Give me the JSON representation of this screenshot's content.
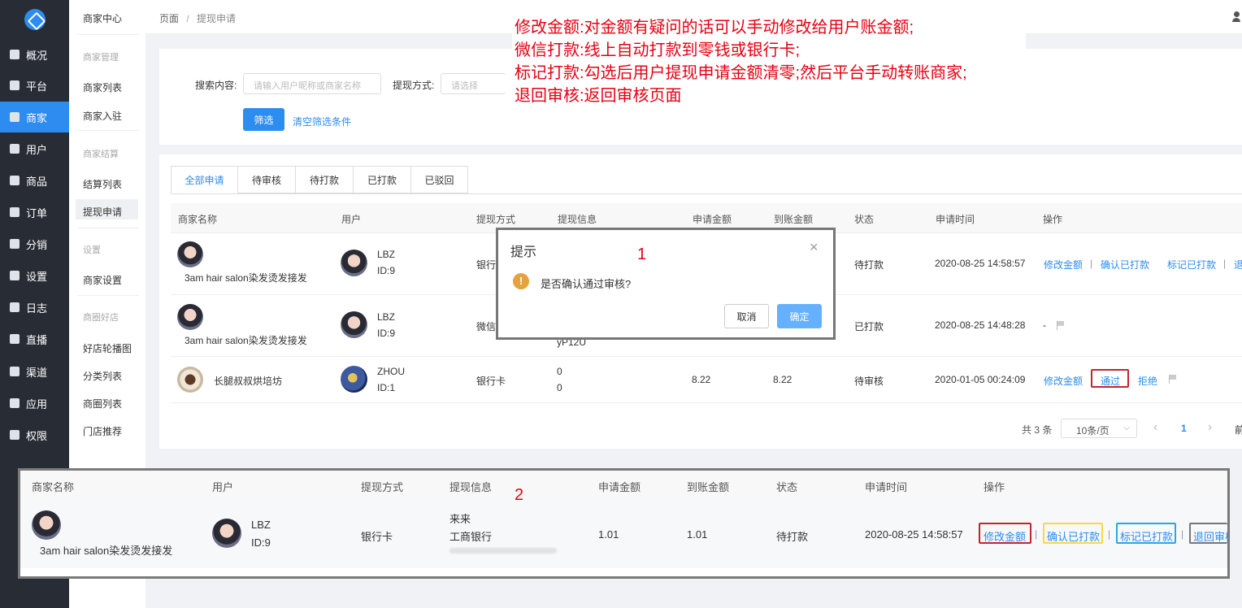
{
  "sidebar": {
    "items": [
      {
        "label": "概况",
        "icon": "dashboard-icon"
      },
      {
        "label": "平台",
        "icon": "monitor-icon"
      },
      {
        "label": "商家",
        "icon": "shop-icon",
        "active": true
      },
      {
        "label": "用户",
        "icon": "user-icon"
      },
      {
        "label": "商品",
        "icon": "goods-icon"
      },
      {
        "label": "订单",
        "icon": "order-icon"
      },
      {
        "label": "分销",
        "icon": "sitemap-icon"
      },
      {
        "label": "设置",
        "icon": "gear-icon"
      },
      {
        "label": "日志",
        "icon": "book-icon"
      },
      {
        "label": "直播",
        "icon": "live-icon"
      },
      {
        "label": "渠道",
        "icon": "channel-icon"
      },
      {
        "label": "应用",
        "icon": "apps-icon"
      },
      {
        "label": "权限",
        "icon": "lock-icon"
      }
    ]
  },
  "submenu": {
    "title": "商家中心",
    "g1": "商家管理",
    "list": "商家列表",
    "settle_in": "商家入驻",
    "g2": "商家结算",
    "settle_list": "结算列表",
    "withdraw": "提现申请",
    "g3": "设置",
    "shop_settings": "商家设置",
    "g4": "商圈好店",
    "carousel": "好店轮播图",
    "category": "分类列表",
    "circle": "商圈列表",
    "recommend": "门店推荐"
  },
  "breadcrumb": {
    "root": "页面",
    "sep": "/",
    "current": "提现申请"
  },
  "filter": {
    "search_label": "搜索内容:",
    "search_placeholder": "请输入用户昵称或商家名称",
    "method_label": "提现方式:",
    "method_placeholder": "请选择",
    "submit": "筛选",
    "clear": "清空筛选条件"
  },
  "tabs": [
    "全部申请",
    "待审核",
    "待打款",
    "已打款",
    "已驳回"
  ],
  "table": {
    "headers": [
      "商家名称",
      "用户",
      "提现方式",
      "提现信息",
      "申请金额",
      "到账金额",
      "状态",
      "申请时间",
      "操作"
    ],
    "rows": [
      {
        "shop": "3am hair salon染发烫发接发",
        "user": "LBZ",
        "uid": "ID:9",
        "method": "银行",
        "status": "待打款",
        "time": "2020-08-25 14:58:57",
        "ops": [
          "修改金额",
          "|",
          "确认已打款",
          "标记已打款",
          "|",
          "退"
        ]
      },
      {
        "shop": "3am hair salon染发烫发接发",
        "user": "LBZ",
        "uid": "ID:9",
        "method": "微信",
        "info": "yP12U",
        "status": "已打款",
        "time": "2020-08-25 14:48:28",
        "dash": "-"
      },
      {
        "shop": "长腿叔叔烘培坊",
        "user": "ZHOU",
        "uid": "ID:1",
        "method": "银行卡",
        "info1": "0",
        "info2": "0",
        "apply": "8.22",
        "arrive": "8.22",
        "status": "待审核",
        "time": "2020-01-05 00:24:09",
        "ops": [
          "修改金额",
          "通过",
          "拒绝"
        ]
      }
    ]
  },
  "pagination": {
    "total": "共 3 条",
    "size": "10条/页",
    "prev": "‹",
    "page": "1",
    "next": "›",
    "more": "前"
  },
  "dialog": {
    "title": "提示",
    "message": "是否确认通过审核?",
    "cancel": "取消",
    "ok": "确定",
    "close": "×",
    "warn": "!"
  },
  "markers": {
    "one": "1",
    "two": "2"
  },
  "annotations": [
    "修改金额:对金额有疑问的话可以手动修改给用户账金额;",
    "微信打款:线上自动打款到零钱或银行卡;",
    "标记打款:勾选后用户提现申请金额清零;然后平台手动转账商家;",
    "退回审核:返回审核页面"
  ],
  "zoom": {
    "headers": [
      "商家名称",
      "用户",
      "提现方式",
      "提现信息",
      "申请金额",
      "到账金额",
      "状态",
      "申请时间",
      "操作"
    ],
    "shop": "3am hair salon染发烫发接发",
    "user": "LBZ",
    "uid": "ID:9",
    "method": "银行卡",
    "info1": "来来",
    "info2": "工商银行",
    "apply": "1.01",
    "arrive": "1.01",
    "status": "待打款",
    "time": "2020-08-25 14:58:57",
    "ops": [
      "修改金额",
      "|",
      "确认已打款",
      "|",
      "标记已打款",
      "|",
      "退回审核"
    ]
  },
  "colors": {
    "accent": "#2d8cf0",
    "annotation": "#e60012",
    "box_red": "#c0262d",
    "box_yellow": "#f5d94a",
    "box_blue": "#2aa7e0",
    "box_gray": "#777777"
  }
}
